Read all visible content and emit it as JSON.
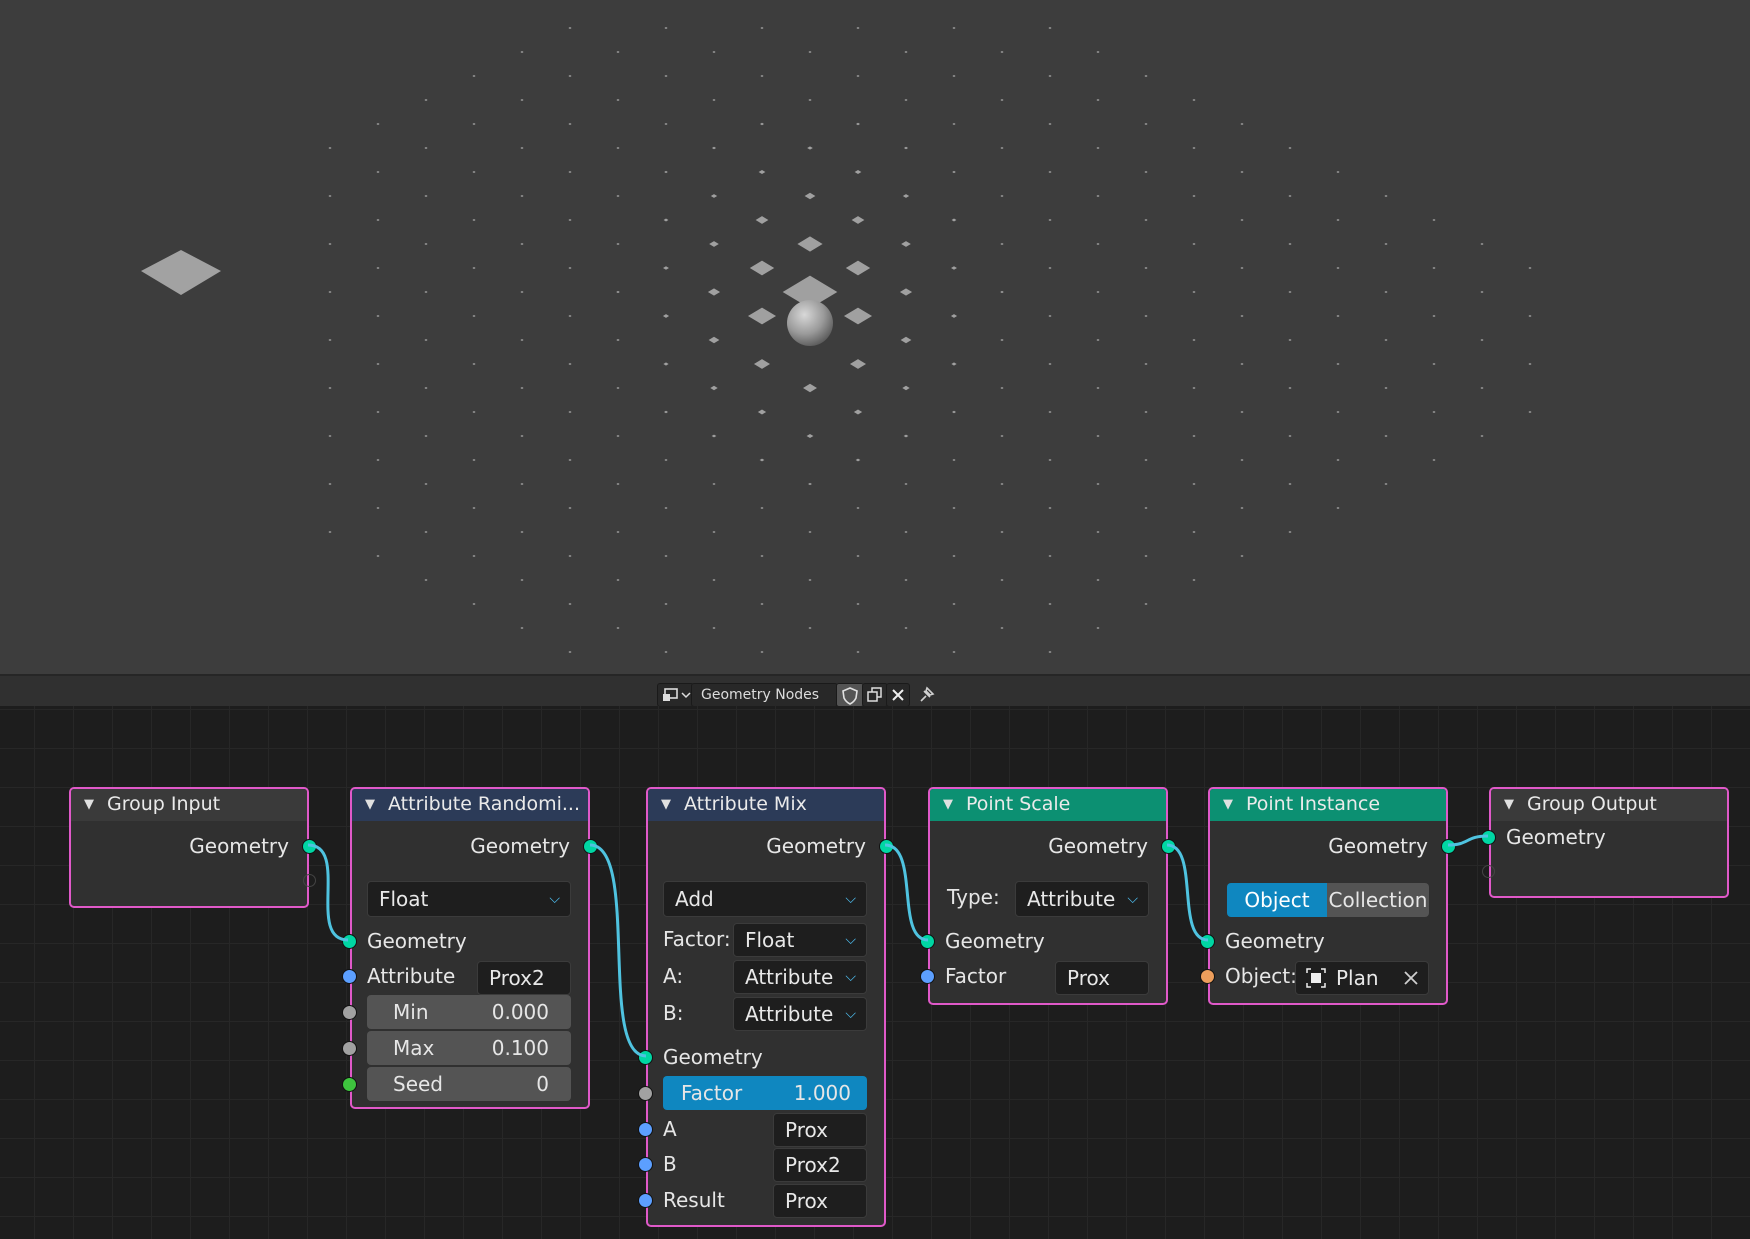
{
  "colors": {
    "geometry_socket": "#00d6a3",
    "vector_socket": "#5c9fff",
    "float_socket": "#a1a1a1",
    "integer_socket": "#3ec43e",
    "object_socket": "#ed9e5c",
    "wire": "#4fc3e0",
    "node_frame": "#e059c9",
    "accent": "#0f87c0"
  },
  "header": {
    "node_tree_name": "Geometry Nodes",
    "editor_type_icon": "node-editor-icon",
    "fake_user_icon": "shield-icon",
    "duplicate_icon": "duplicate-icon",
    "close_icon": "close-icon",
    "pin_icon": "pin-icon"
  },
  "nodes": {
    "group_input": {
      "title": "Group Input",
      "out_geometry": "Geometry"
    },
    "attr_random": {
      "title": "Attribute Randomi...",
      "out_geometry": "Geometry",
      "type": "Float",
      "in_geometry": "Geometry",
      "attribute_label": "Attribute",
      "attribute_value": "Prox2",
      "min_label": "Min",
      "min_value": "0.000",
      "max_label": "Max",
      "max_value": "0.100",
      "seed_label": "Seed",
      "seed_value": "0"
    },
    "attr_mix": {
      "title": "Attribute Mix",
      "out_geometry": "Geometry",
      "blend": "Add",
      "factor_label": "Factor:",
      "factor_type": "Float",
      "a_label": "A:",
      "a_type": "Attribute",
      "b_label": "B:",
      "b_type": "Attribute",
      "in_geometry": "Geometry",
      "factor_slider_label": "Factor",
      "factor_slider_value": "1.000",
      "factor_fraction": 1.0,
      "a_in_label": "A",
      "a_value": "Prox",
      "b_in_label": "B",
      "b_value": "Prox2",
      "result_label": "Result",
      "result_value": "Prox"
    },
    "point_scale": {
      "title": "Point Scale",
      "out_geometry": "Geometry",
      "type_label": "Type:",
      "type_value": "Attribute",
      "in_geometry": "Geometry",
      "factor_label": "Factor",
      "factor_value": "Prox"
    },
    "point_instance": {
      "title": "Point Instance",
      "out_geometry": "Geometry",
      "mode_object": "Object",
      "mode_collection": "Collection",
      "selected_mode": "Object",
      "in_geometry": "Geometry",
      "object_label": "Object:",
      "object_value": "Plan",
      "object_icon": "object-icon",
      "clear_icon": "close-icon"
    },
    "group_output": {
      "title": "Group Output",
      "in_geometry": "Geometry"
    }
  }
}
